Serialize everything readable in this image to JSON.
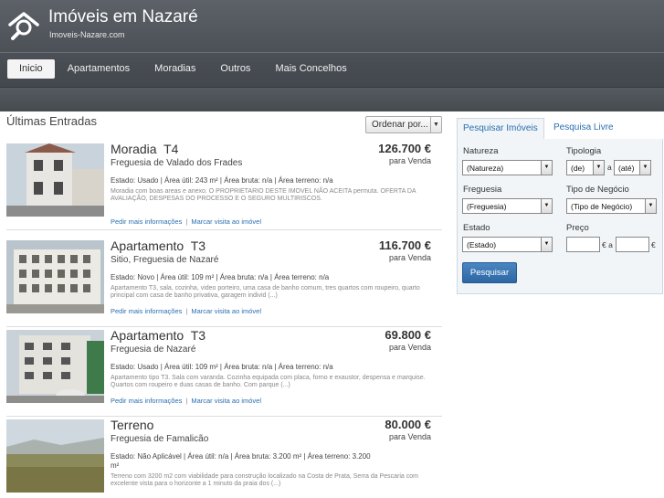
{
  "header": {
    "title": "Imóveis em Nazaré",
    "subtitle": "Imoveis-Nazare.com",
    "logo": "house-search-icon"
  },
  "nav": {
    "items": [
      "Inicio",
      "Apartamentos",
      "Moradias",
      "Outros",
      "Mais Concelhos"
    ],
    "active": "Inicio"
  },
  "main": {
    "section_title": "Últimas Entradas",
    "order_label": "Ordenar por...",
    "listings": [
      {
        "type": "Moradia",
        "typology": "T4",
        "location": "Freguesia de Valado dos Frades",
        "price": "126.700 €",
        "deal": "para Venda",
        "specs": "Estado: Usado  | Área útil: 243 m²  | Área bruta: n/a  | Área terreno: n/a",
        "description": "Moradia com boas areas e anexo. O PROPRIETARIO DESTE IMOVEL NÃO ACEITA permuta. OFERTA DA AVALIAÇÃO, DESPESAS DO PROCESSO E O SEGURO MULTIRISCOS.",
        "link_info": "Pedir mais informações",
        "link_visit": "Marcar visita ao imóvel"
      },
      {
        "type": "Apartamento",
        "typology": "T3",
        "location": "Sitio, Freguesia de Nazaré",
        "price": "116.700 €",
        "deal": "para Venda",
        "specs": "Estado: Novo  | Área útil: 109 m²  | Área bruta: n/a  | Área terreno: n/a",
        "description": "Apartamento T3, sala, cozinha, video porteiro, uma casa de banho comum, tres quartos com roupeiro, quarto principal com casa de banho privativa, garagem individ (...)",
        "link_info": "Pedir mais informações",
        "link_visit": "Marcar visita ao imóvel"
      },
      {
        "type": "Apartamento",
        "typology": "T3",
        "location": "Freguesia de Nazaré",
        "price": "69.800 €",
        "deal": "para Venda",
        "specs": "Estado: Usado  | Área útil: 109 m²  | Área bruta: n/a  | Área terreno: n/a",
        "description": "Apartamento tipo T3. Sala com varanda. Cozinha equipada com placa, forno e exaustor, despensa e marquise. Quartos com roupeiro e duas casas de banho. Com parque (...)",
        "link_info": "Pedir mais informações",
        "link_visit": "Marcar visita ao imóvel"
      },
      {
        "type": "Terreno",
        "typology": "",
        "location": "Freguesia de Famalicão",
        "price": "80.000 €",
        "deal": "para Venda",
        "specs": "Estado: Não Aplicável  | Área útil: n/a  | Área bruta: 3.200 m²  | Área terreno: 3.200 m²",
        "description": "Terreno com 3200 m2 com viabilidade para construção localizado na Costa de Prata, Serra da Pescaria com excelente vista para o horizonte a 1 minuto da praia dos (...)",
        "link_info": "Pedir mais informações",
        "link_visit": "Marcar visita ao imóvel"
      }
    ]
  },
  "search": {
    "tabs": [
      "Pesquisar Imóveis",
      "Pesquisa Livre"
    ],
    "active_tab": "Pesquisar Imóveis",
    "natureza_label": "Natureza",
    "natureza_value": "(Natureza)",
    "tipologia_label": "Tipologia",
    "tipologia_from": "(de)",
    "tipologia_sep": "a",
    "tipologia_to": "(até)",
    "freguesia_label": "Freguesia",
    "freguesia_value": "(Freguesia)",
    "negocio_label": "Tipo de Negócio",
    "negocio_value": "(Tipo de Negócio)",
    "estado_label": "Estado",
    "estado_value": "(Estado)",
    "preco_label": "Preço",
    "preco_unit_from": "€ a",
    "preco_unit_to": "€",
    "button": "Pesquisar"
  }
}
